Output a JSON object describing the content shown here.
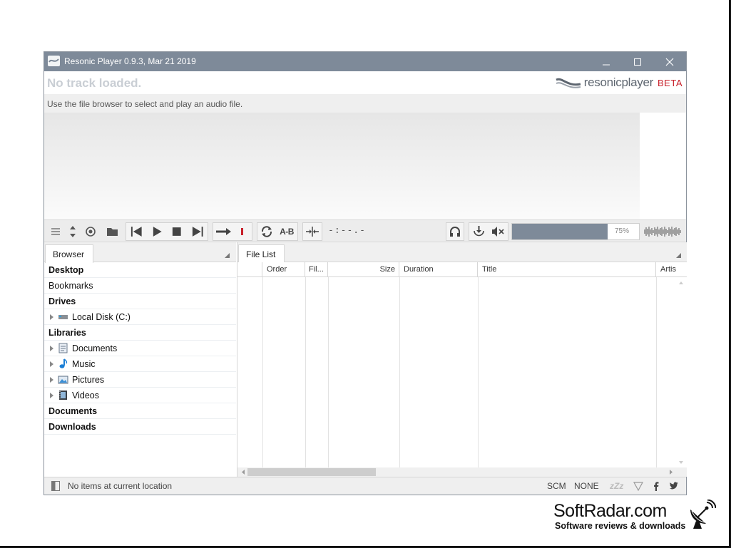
{
  "window": {
    "title": "Resonic Player 0.9.3, Mar 21 2019",
    "controls": [
      "minimize-icon",
      "maximize-icon",
      "close-icon"
    ]
  },
  "track": {
    "title": "No track loaded.",
    "info": "Use the file browser to select and play an audio file."
  },
  "logo": {
    "word": "resonicplayer",
    "badge": "BETA"
  },
  "toolbar": {
    "icons": [
      "menu-icon",
      "reorder-icon",
      "target-icon",
      "folder-icon",
      "previous-icon",
      "play-icon",
      "stop-icon",
      "next-icon",
      "continue-arrow-icon",
      "record-marker-icon",
      "loop-icon",
      "ab-repeat-icon",
      "scrub-icon",
      "headphones-icon",
      "download-icon",
      "mute-icon"
    ],
    "ab_label": "A-B",
    "time": "-:--.-",
    "volume_label": "75%",
    "volume_level": 0.75
  },
  "browser": {
    "tab_label": "Browser",
    "items": [
      {
        "label": "Desktop",
        "kind": "header"
      },
      {
        "label": "Bookmarks",
        "kind": "plain"
      },
      {
        "label": "Drives",
        "kind": "header"
      },
      {
        "label": "Local Disk (C:)",
        "kind": "child",
        "icon": "drive-icon"
      },
      {
        "label": "Libraries",
        "kind": "header"
      },
      {
        "label": "Documents",
        "kind": "child",
        "icon": "documents-icon"
      },
      {
        "label": "Music",
        "kind": "child",
        "icon": "music-note-icon"
      },
      {
        "label": "Pictures",
        "kind": "child",
        "icon": "pictures-icon"
      },
      {
        "label": "Videos",
        "kind": "child",
        "icon": "videos-icon"
      },
      {
        "label": "Documents",
        "kind": "header"
      },
      {
        "label": "Downloads",
        "kind": "header"
      }
    ]
  },
  "filelist": {
    "tab_label": "File List",
    "columns": [
      "",
      "Order",
      "Fil...",
      "Size",
      "Duration",
      "Title",
      "Artis"
    ]
  },
  "status": {
    "text": "No items at current location",
    "scm": "SCM",
    "none": "NONE",
    "sleep": "zZz"
  },
  "watermark": {
    "title": "SoftRadar.com",
    "subtitle": "Software reviews & downloads"
  },
  "colors": {
    "titlebar": "#7e8a99",
    "accent_red": "#c8202a"
  }
}
